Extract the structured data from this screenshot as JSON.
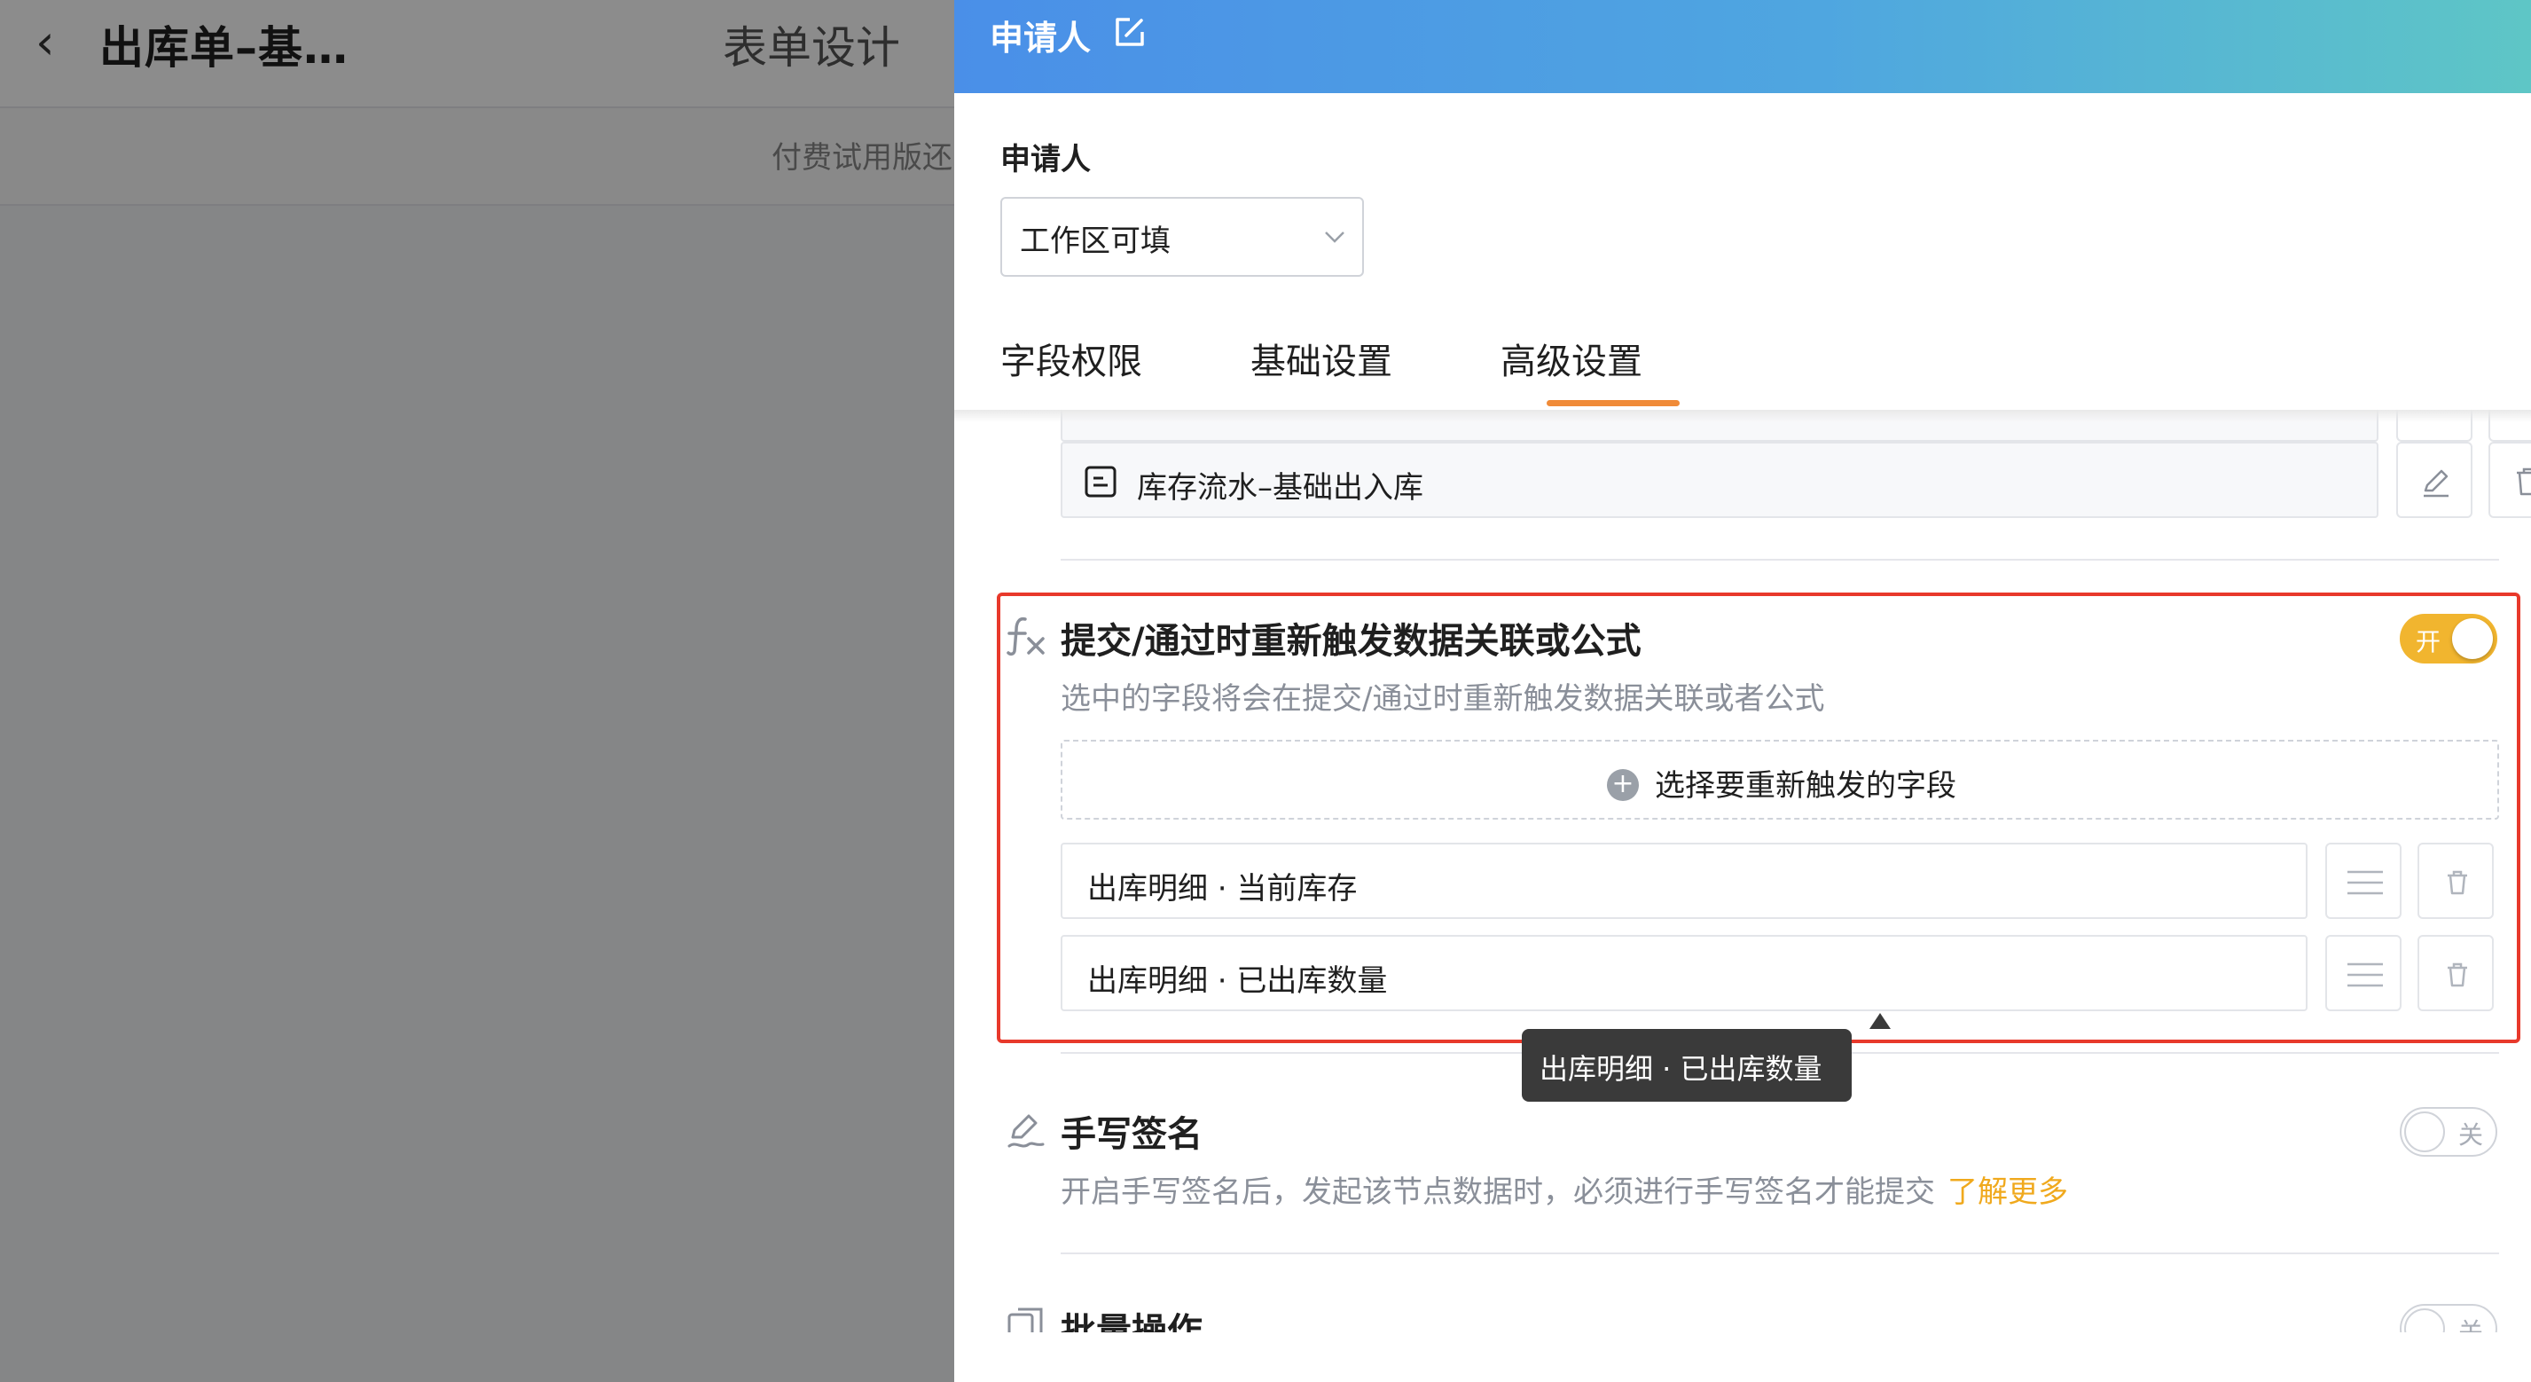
{
  "background_page": {
    "back_icon": "chevron-left-icon",
    "title": "出库单–基…",
    "tab": "表单设计",
    "notice": "付费试用版还"
  },
  "drawer": {
    "title": "申请人",
    "edit_icon": "edit-icon",
    "field_label": "申请人",
    "permission_select": {
      "value": "工作区可填"
    },
    "tabs": [
      "字段权限",
      "基础设置",
      "高级设置"
    ],
    "active_tab": "高级设置",
    "linked_form": {
      "label": "库存流水–基础出入库",
      "icon": "form-icon"
    },
    "retrigger": {
      "title": "提交/通过时重新触发数据关联或公式",
      "description": "选中的字段将会在提交/通过时重新触发数据关联或者公式",
      "toggle_label": "开",
      "toggle_on": true,
      "add_field_label": "选择要重新触发的字段",
      "fields": [
        "出库明细 · 当前库存",
        "出库明细 · 已出库数量"
      ],
      "tooltip": "出库明细 · 已出库数量"
    },
    "signature": {
      "title": "手写签名",
      "description": "开启手写签名后，发起该节点数据时，必须进行手写签名才能提交",
      "learn_more": "了解更多",
      "toggle_label": "关",
      "toggle_on": false
    },
    "batch": {
      "title": "批量操作",
      "toggle_label": "关",
      "toggle_on": false
    }
  },
  "colors": {
    "accent_orange": "#f08b38",
    "toggle_on": "#f1b52f",
    "highlight_red": "#e8392b",
    "header_gradient_start": "#4a8fe8",
    "header_gradient_end": "#5ec6c6"
  }
}
